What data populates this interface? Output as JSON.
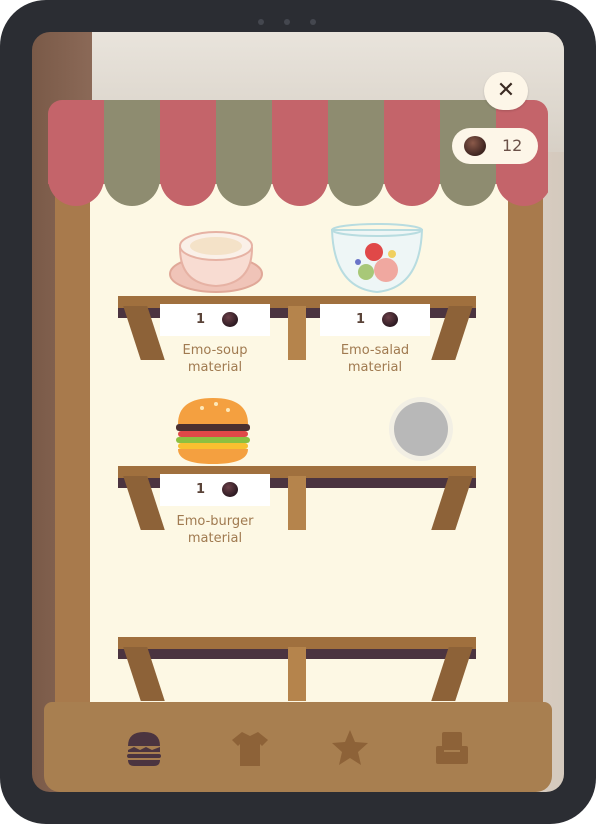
{
  "header": {
    "close_label": "✕",
    "currency_count": "12",
    "currency_icon": "coin-icon"
  },
  "items": [
    {
      "name": "Emo-soup",
      "sub": "material",
      "price": "1",
      "icon": "soup-bowl-icon"
    },
    {
      "name": "Emo-salad",
      "sub": "material",
      "price": "1",
      "icon": "salad-bowl-icon"
    },
    {
      "name": "Emo-burger",
      "sub": "material",
      "price": "1",
      "icon": "burger-icon"
    }
  ],
  "locked_item": {
    "icon": "locked-slot-icon"
  },
  "tabs": [
    {
      "icon": "burger-icon",
      "active": true
    },
    {
      "icon": "shirt-icon",
      "active": false
    },
    {
      "icon": "star-icon",
      "active": false
    },
    {
      "icon": "armchair-icon",
      "active": false
    }
  ],
  "colors": {
    "awning_red": "#c4646a",
    "awning_olive": "#8e8c70",
    "wood": "#a87a4c",
    "paper": "#fdf8e4",
    "tab_active": "#4b3440",
    "tab_inactive": "#8d6238"
  }
}
